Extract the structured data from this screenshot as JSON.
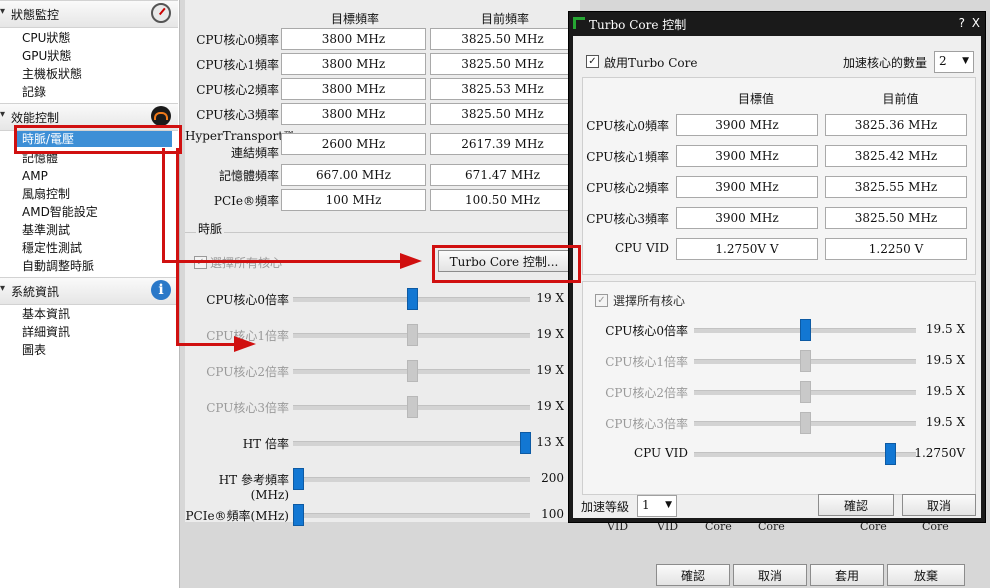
{
  "sidebar": {
    "status_section": "狀態監控",
    "status_items": [
      "CPU狀態",
      "GPU狀態",
      "主機板狀態",
      "記錄"
    ],
    "perf_section": "效能控制",
    "perf_items": [
      "時脈/電壓",
      "記憶體",
      "AMP",
      "風扇控制",
      "AMD智能設定",
      "基準測試",
      "穩定性測試",
      "自動調整時脈"
    ],
    "sys_section": "系統資訊",
    "sys_items": [
      "基本資訊",
      "詳細資訊",
      "圖表"
    ],
    "icons": [
      "gauge-icon",
      "performance-icon",
      "info-icon"
    ]
  },
  "main": {
    "col_target": "目標頻率",
    "col_current": "目前頻率",
    "rows": [
      {
        "label": "CPU核心0頻率",
        "target": "3800 MHz",
        "current": "3825.50 MHz"
      },
      {
        "label": "CPU核心1頻率",
        "target": "3800 MHz",
        "current": "3825.50 MHz"
      },
      {
        "label": "CPU核心2頻率",
        "target": "3800 MHz",
        "current": "3825.53 MHz"
      },
      {
        "label": "CPU核心3頻率",
        "target": "3800 MHz",
        "current": "3825.50 MHz"
      },
      {
        "label": "HyperTransport™",
        "label2": "連結頻率",
        "target": "2600 MHz",
        "current": "2617.39 MHz"
      },
      {
        "label": "記憶體頻率",
        "target": "667.00 MHz",
        "current": "671.47 MHz"
      },
      {
        "label": "PCIe®頻率",
        "target": "100 MHz",
        "current": "100.50 MHz"
      }
    ],
    "clock_group": "時脈",
    "select_all": "選擇所有核心",
    "turbo_button": "Turbo Core 控制...",
    "sliders": [
      {
        "label": "CPU核心0倍率",
        "value": "19 X",
        "level": 0.5,
        "enabled": true
      },
      {
        "label": "CPU核心1倍率",
        "value": "19 X",
        "level": 0.5,
        "enabled": false
      },
      {
        "label": "CPU核心2倍率",
        "value": "19 X",
        "level": 0.5,
        "enabled": false
      },
      {
        "label": "CPU核心3倍率",
        "value": "19 X",
        "level": 0.5,
        "enabled": false
      },
      {
        "label": "HT 倍率",
        "value": "13 X",
        "level": 1.0,
        "enabled": true
      },
      {
        "label": "HT 參考頻率(MHz)",
        "value": "200",
        "level": 0.0,
        "enabled": true
      },
      {
        "label": "PCIe®頻率(MHz)",
        "value": "100",
        "level": 0.0,
        "enabled": true
      }
    ]
  },
  "background_labels": [
    "VID",
    "VID",
    "Core",
    "Core",
    "Core",
    "Core"
  ],
  "bottom_buttons": [
    "確認",
    "取消",
    "套用",
    "放棄"
  ],
  "dialog": {
    "title": "Turbo Core 控制",
    "help": "?",
    "close": "X",
    "enable_label": "啟用Turbo Core",
    "boost_cores_label": "加速核心的數量",
    "boost_cores_value": "2",
    "col_target": "目標值",
    "col_current": "目前值",
    "rows": [
      {
        "label": "CPU核心0頻率",
        "target": "3900 MHz",
        "current": "3825.36 MHz"
      },
      {
        "label": "CPU核心1頻率",
        "target": "3900 MHz",
        "current": "3825.42 MHz"
      },
      {
        "label": "CPU核心2頻率",
        "target": "3900 MHz",
        "current": "3825.55 MHz"
      },
      {
        "label": "CPU核心3頻率",
        "target": "3900 MHz",
        "current": "3825.50 MHz"
      },
      {
        "label": "CPU VID",
        "target": "1.2750V V",
        "current": "1.2250 V"
      }
    ],
    "select_all": "選擇所有核心",
    "sliders": [
      {
        "label": "CPU核心0倍率",
        "value": "19.5 X",
        "level": 0.5,
        "enabled": true
      },
      {
        "label": "CPU核心1倍率",
        "value": "19.5 X",
        "level": 0.5,
        "enabled": false
      },
      {
        "label": "CPU核心2倍率",
        "value": "19.5 X",
        "level": 0.5,
        "enabled": false
      },
      {
        "label": "CPU核心3倍率",
        "value": "19.5 X",
        "level": 0.5,
        "enabled": false
      },
      {
        "label": "CPU VID",
        "value": "1.2750V",
        "level": 0.9,
        "enabled": true
      }
    ],
    "boost_level_label": "加速等級",
    "boost_level_value": "1",
    "ok": "確認",
    "cancel": "取消"
  },
  "colors": {
    "accent": "#1277d3",
    "selection": "#3d8fd6",
    "annotation": "#d01010",
    "dialog_frame": "#1a1a1a"
  }
}
